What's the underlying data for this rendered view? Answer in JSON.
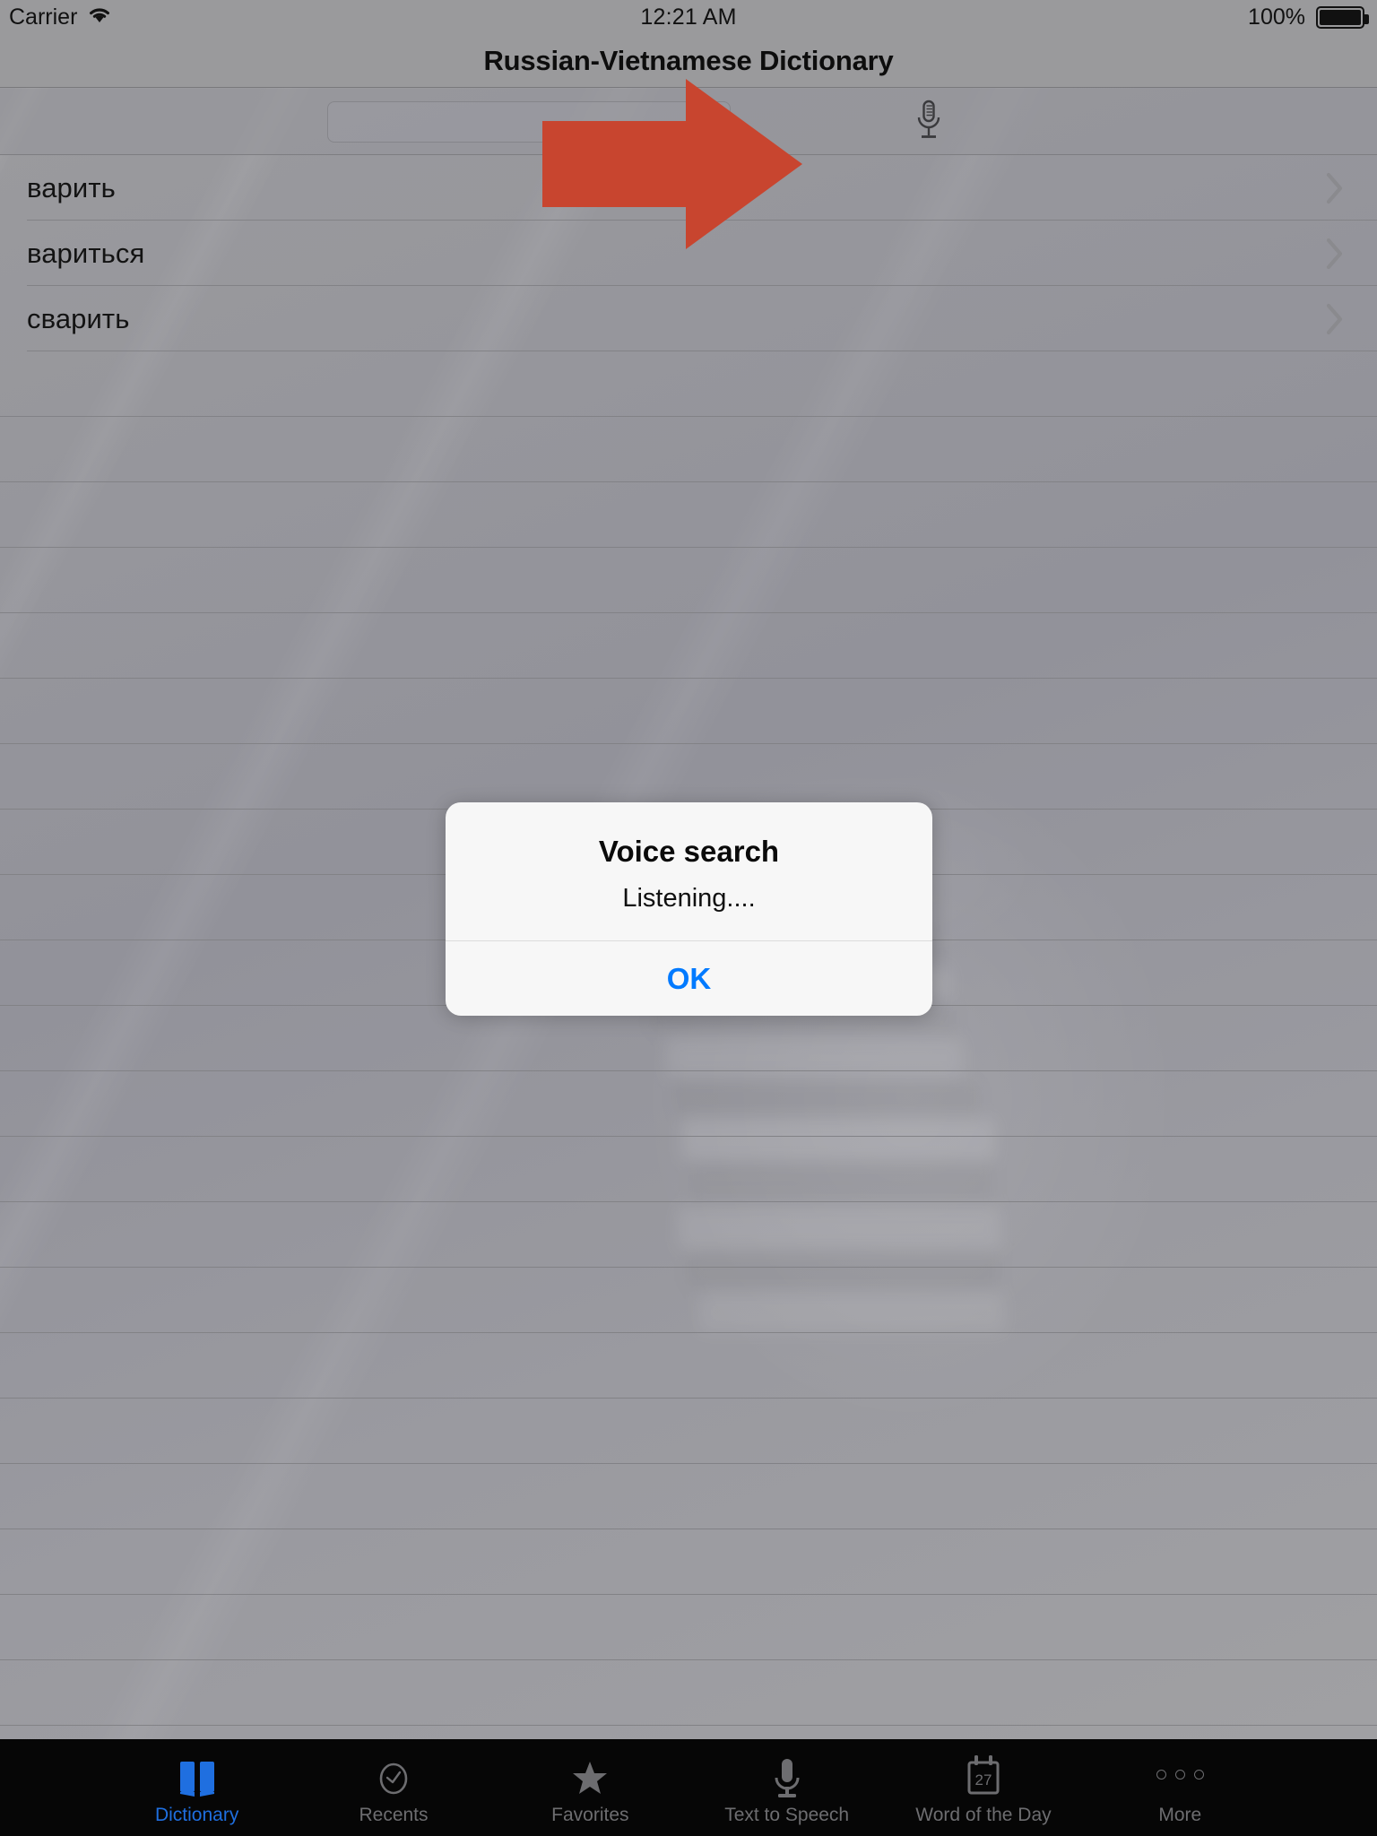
{
  "status_bar": {
    "carrier": "Carrier",
    "wifi_icon": "wifi-icon",
    "time": "12:21 AM",
    "battery_percent": "100%",
    "battery_icon": "battery-full-icon"
  },
  "nav": {
    "title": "Russian-Vietnamese Dictionary"
  },
  "search": {
    "value": "",
    "placeholder": "",
    "mic_icon": "microphone-icon"
  },
  "pointer": {
    "name": "red-arrow-annotation",
    "color": "#c8452f",
    "points_to": "microphone-icon"
  },
  "results": {
    "items": [
      {
        "word": "варить",
        "accessory": "chevron-right-icon"
      },
      {
        "word": "вариться",
        "accessory": "chevron-right-icon"
      },
      {
        "word": "сварить",
        "accessory": "chevron-right-icon"
      }
    ],
    "empty_row_count": 21
  },
  "alert": {
    "title": "Voice search",
    "message": "Listening....",
    "ok_label": "OK",
    "ok_color": "#007aff"
  },
  "tab_bar": {
    "active_color": "#1f6fe0",
    "inactive_color": "#6d6d70",
    "items": [
      {
        "label": "Dictionary",
        "icon": "book-icon",
        "active": true
      },
      {
        "label": "Recents",
        "icon": "clock-icon",
        "active": false
      },
      {
        "label": "Favorites",
        "icon": "star-icon",
        "active": false
      },
      {
        "label": "Text to Speech",
        "icon": "microphone-icon",
        "active": false
      },
      {
        "label": "Word of the Day",
        "icon": "calendar-icon",
        "active": false,
        "calendar_day": "27"
      },
      {
        "label": "More",
        "icon": "ellipsis-icon",
        "active": false
      }
    ]
  }
}
